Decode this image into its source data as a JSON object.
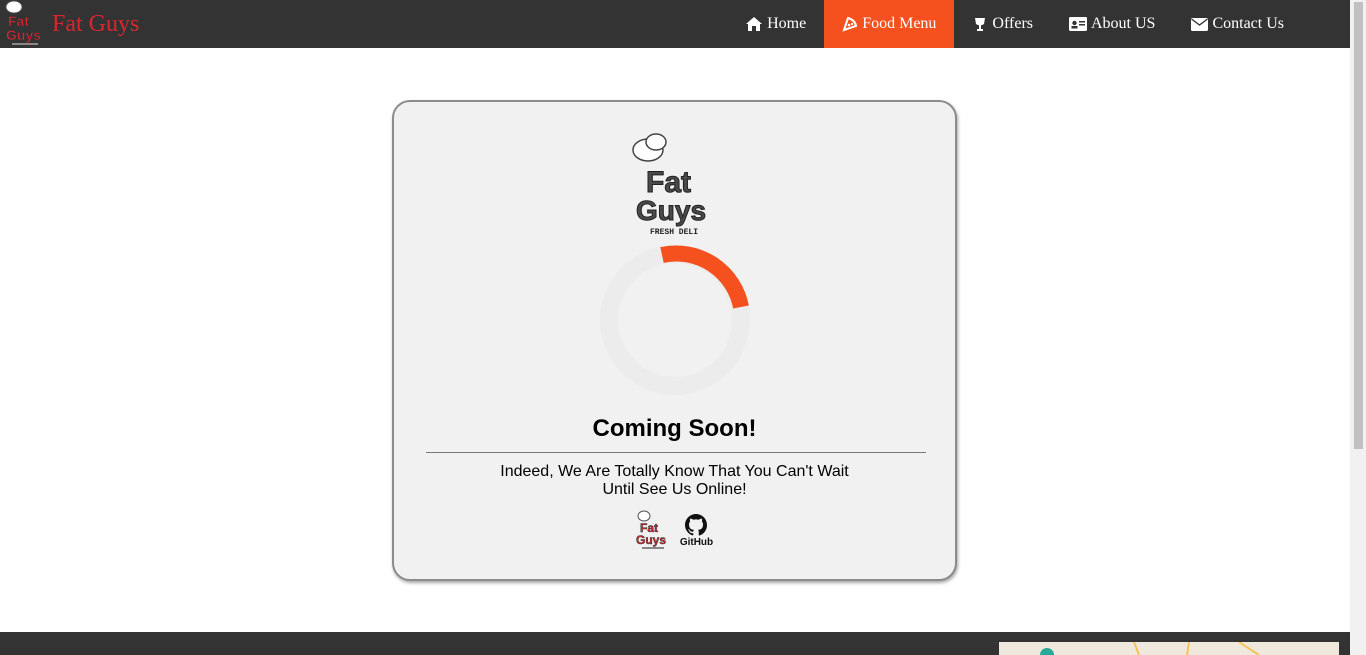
{
  "brand": {
    "name": "Fat Guys",
    "logo_text": "Fat Guys",
    "logo_subtext": "FRESH DELI",
    "color": "#d8262e"
  },
  "nav": {
    "items": [
      {
        "label": "Home",
        "icon": "home-icon",
        "active": false
      },
      {
        "label": "Food Menu",
        "icon": "pizza-icon",
        "active": true
      },
      {
        "label": "Offers",
        "icon": "trophy-icon",
        "active": false
      },
      {
        "label": "About US",
        "icon": "id-card-icon",
        "active": false
      },
      {
        "label": "Contact Us",
        "icon": "envelope-icon",
        "active": false
      }
    ],
    "background": "#333333",
    "active_color": "#f4511e"
  },
  "card": {
    "logo_text": "Fat Guys",
    "logo_subtext": "FRESH DELI",
    "title": "Coming Soon!",
    "message_line1": "Indeed, We Are Totally Know That You Can't Wait",
    "message_line2": "Until See Us Online!",
    "links": [
      {
        "label": "",
        "icon": "fat-guys-logo-icon"
      },
      {
        "label": "GitHub",
        "icon": "github-icon"
      }
    ],
    "spinner_color": "#f4511e"
  },
  "footer": {
    "background": "#333333"
  }
}
